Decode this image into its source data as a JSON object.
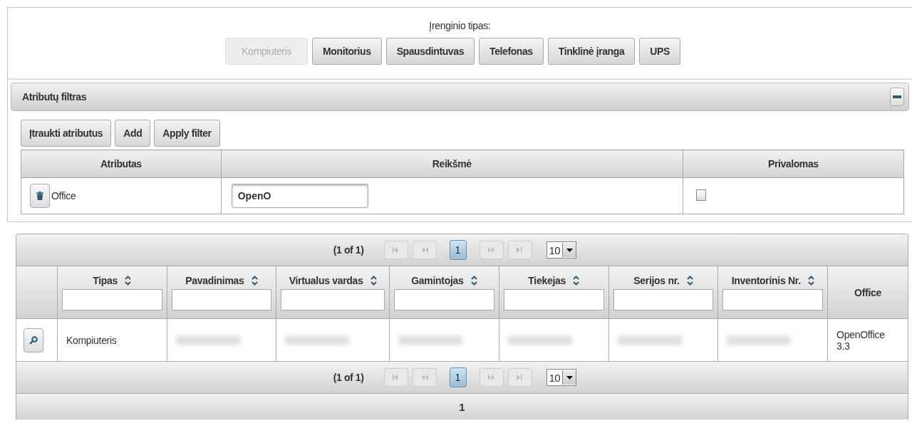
{
  "device_type": {
    "label": "Įrenginio tipas:",
    "buttons": [
      {
        "label": "Kompiuteris",
        "disabled": true
      },
      {
        "label": "Monitorius",
        "disabled": false
      },
      {
        "label": "Spausdintuvas",
        "disabled": false
      },
      {
        "label": "Telefonas",
        "disabled": false
      },
      {
        "label": "Tinklinė įranga",
        "disabled": false
      },
      {
        "label": "UPS",
        "disabled": false
      }
    ]
  },
  "attribute_filter": {
    "title": "Atributų filtras",
    "expanded": true,
    "buttons": [
      "Įtraukti atributus",
      "Add",
      "Apply filter"
    ],
    "columns": [
      "Atributas",
      "Reikšmė",
      "Privalomas"
    ],
    "rows": [
      {
        "attribute": "Office",
        "value": "OpenO",
        "required": false
      }
    ]
  },
  "results": {
    "paginator_top": {
      "summary": "(1 of 1)",
      "nav": [
        {
          "kind": "first",
          "disabled": true
        },
        {
          "kind": "prev",
          "disabled": true
        },
        {
          "kind": "page",
          "label": "1",
          "selected": true
        },
        {
          "kind": "next",
          "disabled": true
        },
        {
          "kind": "last",
          "disabled": true
        }
      ],
      "page_size": "10"
    },
    "columns": [
      {
        "label": "Tipas",
        "sortable": true,
        "filter": true
      },
      {
        "label": "Pavadinimas",
        "sortable": true,
        "filter": true
      },
      {
        "label": "Virtualus vardas",
        "sortable": true,
        "filter": true
      },
      {
        "label": "Gamintojas",
        "sortable": true,
        "filter": true
      },
      {
        "label": "Tiekejas",
        "sortable": true,
        "filter": true
      },
      {
        "label": "Serijos nr.",
        "sortable": true,
        "filter": true
      },
      {
        "label": "Inventorinis Nr.",
        "sortable": true,
        "filter": true
      },
      {
        "label": "Office",
        "sortable": false,
        "filter": false
      }
    ],
    "rows": [
      {
        "cells": [
          {
            "kind": "text",
            "text": "Kompiuteris"
          },
          {
            "kind": "redacted"
          },
          {
            "kind": "redacted"
          },
          {
            "kind": "redacted"
          },
          {
            "kind": "redacted"
          },
          {
            "kind": "redacted"
          },
          {
            "kind": "redacted"
          },
          {
            "kind": "text",
            "text": "OpenOffice 3.3"
          }
        ]
      }
    ],
    "paginator_bottom": {
      "summary": "(1 of 1)",
      "nav": [
        {
          "kind": "first",
          "disabled": true
        },
        {
          "kind": "prev",
          "disabled": true
        },
        {
          "kind": "page",
          "label": "1",
          "selected": true
        },
        {
          "kind": "next",
          "disabled": true
        },
        {
          "kind": "last",
          "disabled": true
        }
      ],
      "page_size": "10"
    },
    "footer": "1"
  }
}
